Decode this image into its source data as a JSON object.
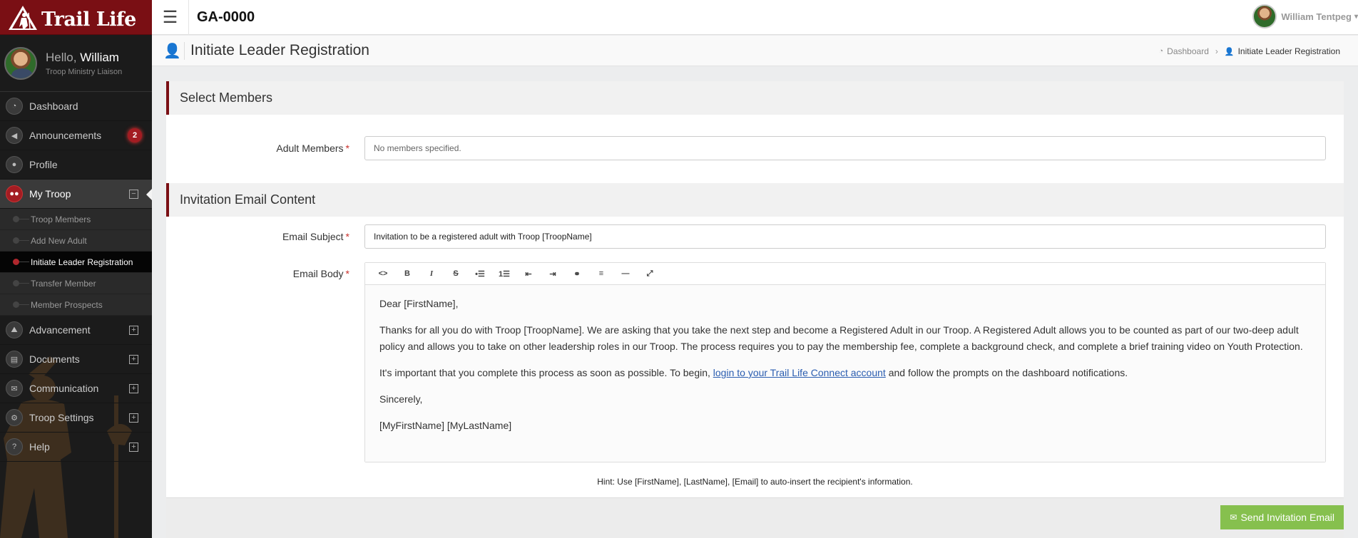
{
  "brand": {
    "name": "Trail Life"
  },
  "user": {
    "greeting": "Hello,",
    "first_name": "William",
    "role": "Troop Ministry Liaison",
    "full_name": "William Tentpeg"
  },
  "topbar": {
    "unit": "GA-0000"
  },
  "sidebar": {
    "items": [
      {
        "label": "Dashboard"
      },
      {
        "label": "Announcements",
        "badge": "2"
      },
      {
        "label": "Profile"
      },
      {
        "label": "My Troop"
      },
      {
        "label": "Advancement"
      },
      {
        "label": "Documents"
      },
      {
        "label": "Communication"
      },
      {
        "label": "Troop Settings"
      },
      {
        "label": "Help"
      }
    ],
    "subitems": [
      {
        "label": "Troop Members"
      },
      {
        "label": "Add New Adult"
      },
      {
        "label": "Initiate Leader Registration"
      },
      {
        "label": "Transfer Member"
      },
      {
        "label": "Member Prospects"
      }
    ]
  },
  "page": {
    "title": "Initiate Leader Registration"
  },
  "breadcrumb": {
    "home": "Dashboard",
    "current": "Initiate Leader Registration"
  },
  "select_members": {
    "heading": "Select Members",
    "adult_label": "Adult Members",
    "adult_value": "No members specified."
  },
  "email": {
    "heading": "Invitation Email Content",
    "subject_label": "Email Subject",
    "subject_value": "Invitation to be a registered adult with Troop [TroopName]",
    "body_label": "Email Body",
    "body": {
      "p1": "Dear [FirstName],",
      "p2": "Thanks for all you do with Troop [TroopName]. We are asking that you take the next step and become a Registered Adult in our Troop. A Registered Adult allows you to be counted as part of our two-deep adult policy and allows you to take on other leadership roles in our Troop. The process requires you to pay the membership fee, complete a background check, and complete a brief training video on Youth Protection.",
      "p3_before": "It's important that you complete this process as soon as possible. To begin, ",
      "p3_link": "login to your Trail Life Connect account",
      "p3_after": " and follow the prompts on the dashboard notifications.",
      "p4": "Sincerely,",
      "p5": "[MyFirstName] [MyLastName]"
    },
    "hint": "Hint: Use [FirstName], [LastName], [Email] to auto-insert the recipient's information.",
    "required_mark": "*"
  },
  "toolbar_icons": [
    "code-view-icon",
    "bold-icon",
    "italic-icon",
    "strikethrough-icon",
    "bullet-list-icon",
    "numbered-list-icon",
    "outdent-icon",
    "indent-icon",
    "link-icon",
    "align-icon",
    "horizontal-rule-icon",
    "fullscreen-icon"
  ],
  "actions": {
    "send_label": "Send Invitation Email"
  },
  "colors": {
    "brand_red": "#7a0f14",
    "send_green": "#86c04e"
  }
}
